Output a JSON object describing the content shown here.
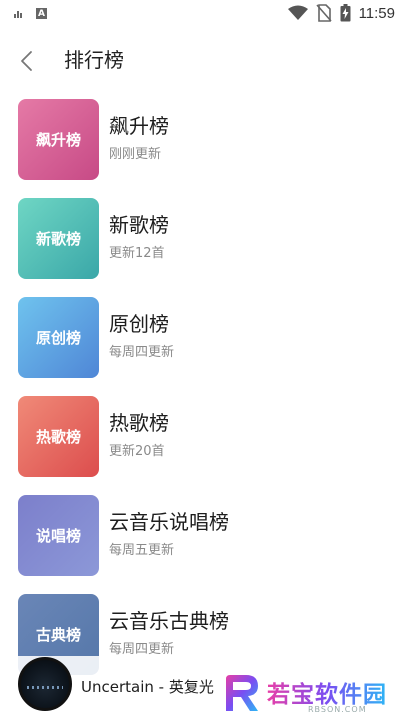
{
  "status_bar": {
    "time": "11:59",
    "icons": [
      "signal-bars-icon",
      "text-a-icon",
      "wifi-icon",
      "no-sim-icon",
      "battery-charging-icon"
    ]
  },
  "header": {
    "title": "排行榜"
  },
  "charts": [
    {
      "cover_text": "飙升榜",
      "title": "飙升榜",
      "subtitle": "刚刚更新",
      "cover_from": "#e57aa6",
      "cover_to": "#c74a86"
    },
    {
      "cover_text": "新歌榜",
      "title": "新歌榜",
      "subtitle": "更新12首",
      "cover_from": "#6fd6c4",
      "cover_to": "#3aa7a8"
    },
    {
      "cover_text": "原创榜",
      "title": "原创榜",
      "subtitle": "每周四更新",
      "cover_from": "#6fc3ee",
      "cover_to": "#4f86d6"
    },
    {
      "cover_text": "热歌榜",
      "title": "热歌榜",
      "subtitle": "更新20首",
      "cover_from": "#f08a78",
      "cover_to": "#dc4d4d"
    },
    {
      "cover_text": "说唱榜",
      "title": "云音乐说唱榜",
      "subtitle": "每周五更新",
      "cover_from": "#7c7fcb",
      "cover_to": "#8c98d8"
    },
    {
      "cover_text": "古典榜",
      "title": "云音乐古典榜",
      "subtitle": "每周四更新",
      "cover_from": "#6a86b7",
      "cover_to": "#5577a9"
    }
  ],
  "player": {
    "song": "Uncertain - 英复光"
  },
  "watermark": {
    "text": "若宝软件园",
    "url": "RBSON.COM"
  }
}
